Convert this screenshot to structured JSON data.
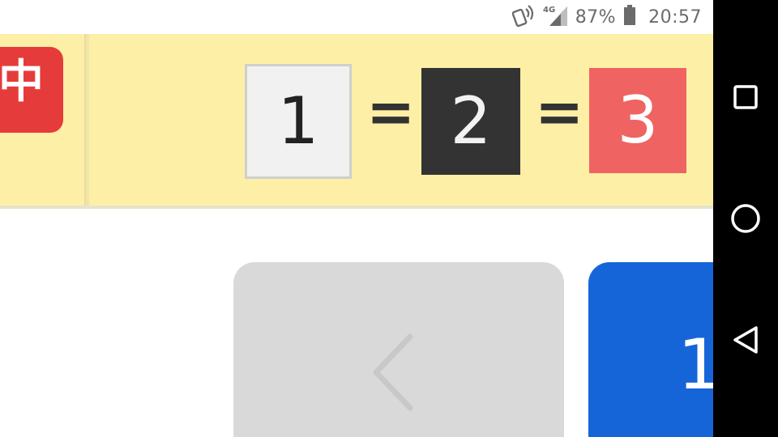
{
  "status_bar": {
    "network_type": "4G",
    "battery_percent": "87%",
    "time": "20:57",
    "icons": [
      "nfc-icon",
      "cell-signal-icon",
      "battery-icon"
    ]
  },
  "banner": {
    "badge_text": "中",
    "equation": {
      "tile1": "1",
      "eq1": "=",
      "tile2": "2",
      "eq2": "=",
      "tile3": "3"
    }
  },
  "controls": {
    "prev_icon": "chevron-left-icon",
    "page_label": "1"
  },
  "nav_bar": {
    "buttons": [
      "recents-icon",
      "home-icon",
      "back-icon"
    ]
  },
  "colors": {
    "banner_bg": "#fdefa6",
    "badge_red": "#e63b3b",
    "tile_dark": "#333333",
    "tile_red": "#f06363",
    "tile_light": "#f1f1f1",
    "prev_button_bg": "#d9d9d9",
    "page_button_blue": "#1565d8",
    "nav_bar_bg": "#000000"
  }
}
